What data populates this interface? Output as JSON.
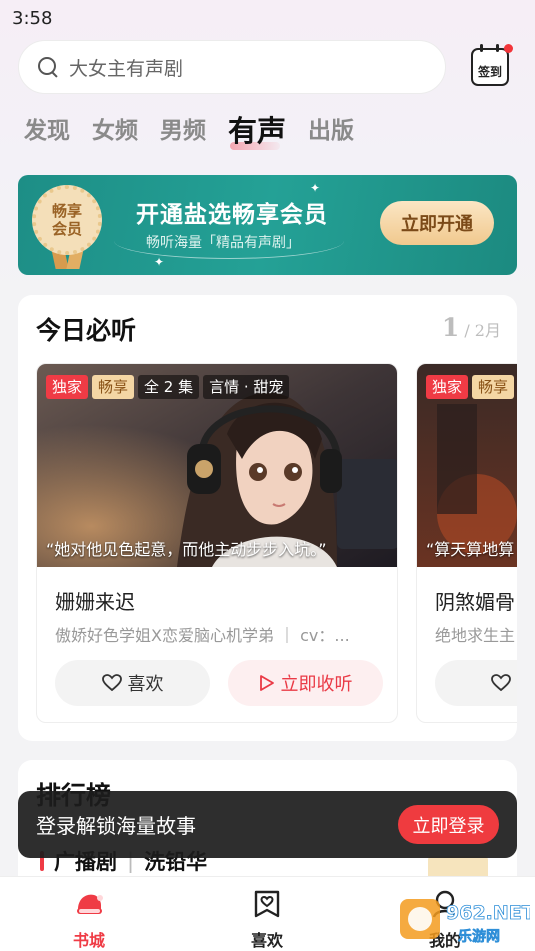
{
  "status_bar": {
    "time": "3:58"
  },
  "search": {
    "placeholder": "大女主有声剧"
  },
  "header": {
    "checkin_label": "签到"
  },
  "tabs": [
    {
      "label": "发现",
      "active": false
    },
    {
      "label": "女频",
      "active": false
    },
    {
      "label": "男频",
      "active": false
    },
    {
      "label": "有声",
      "active": true
    },
    {
      "label": "出版",
      "active": false
    }
  ],
  "vip_banner": {
    "badge_line1": "畅享",
    "badge_line2": "会员",
    "title": "开通盐选畅享会员",
    "subtitle": "畅听海量「精品有声剧」",
    "button_label": "立即开通"
  },
  "today": {
    "title": "今日必听",
    "page_current": "1",
    "page_total": "/ 2月",
    "books": [
      {
        "tags": [
          "独家",
          "畅享",
          "全 2 集",
          "言情 · 甜宠"
        ],
        "quote": "“她对他见色起意，而他主动步步入坑。”",
        "name": "姗姗来迟",
        "desc": "傲娇好色学姐X恋爱脑心机学弟 ｜ cv：...",
        "like_label": "喜欢",
        "listen_label": "立即收听"
      },
      {
        "tags": [
          "独家",
          "畅享"
        ],
        "quote": "“算天算地算",
        "name": "阴煞媚骨",
        "desc": "绝地求生主",
        "like_label": "喜"
      }
    ]
  },
  "ranking": {
    "title": "排行榜",
    "tab1": "广播剧",
    "tab2": "洗铅华"
  },
  "toast": {
    "text": "登录解锁海量故事",
    "button_label": "立即登录"
  },
  "bottom_nav": [
    {
      "label": "书城",
      "icon": "bookstore-hat-icon",
      "active": true
    },
    {
      "label": "喜欢",
      "icon": "heart-bookmark-icon",
      "active": false
    },
    {
      "label": "我的",
      "icon": "profile-icon",
      "active": false
    }
  ],
  "watermark": {
    "text": "962.NET",
    "subtext": "乐游网"
  },
  "colors": {
    "accent_red": "#ef3b45",
    "vip_green": "#1d8e86",
    "vip_gold": "#f1c98e"
  }
}
